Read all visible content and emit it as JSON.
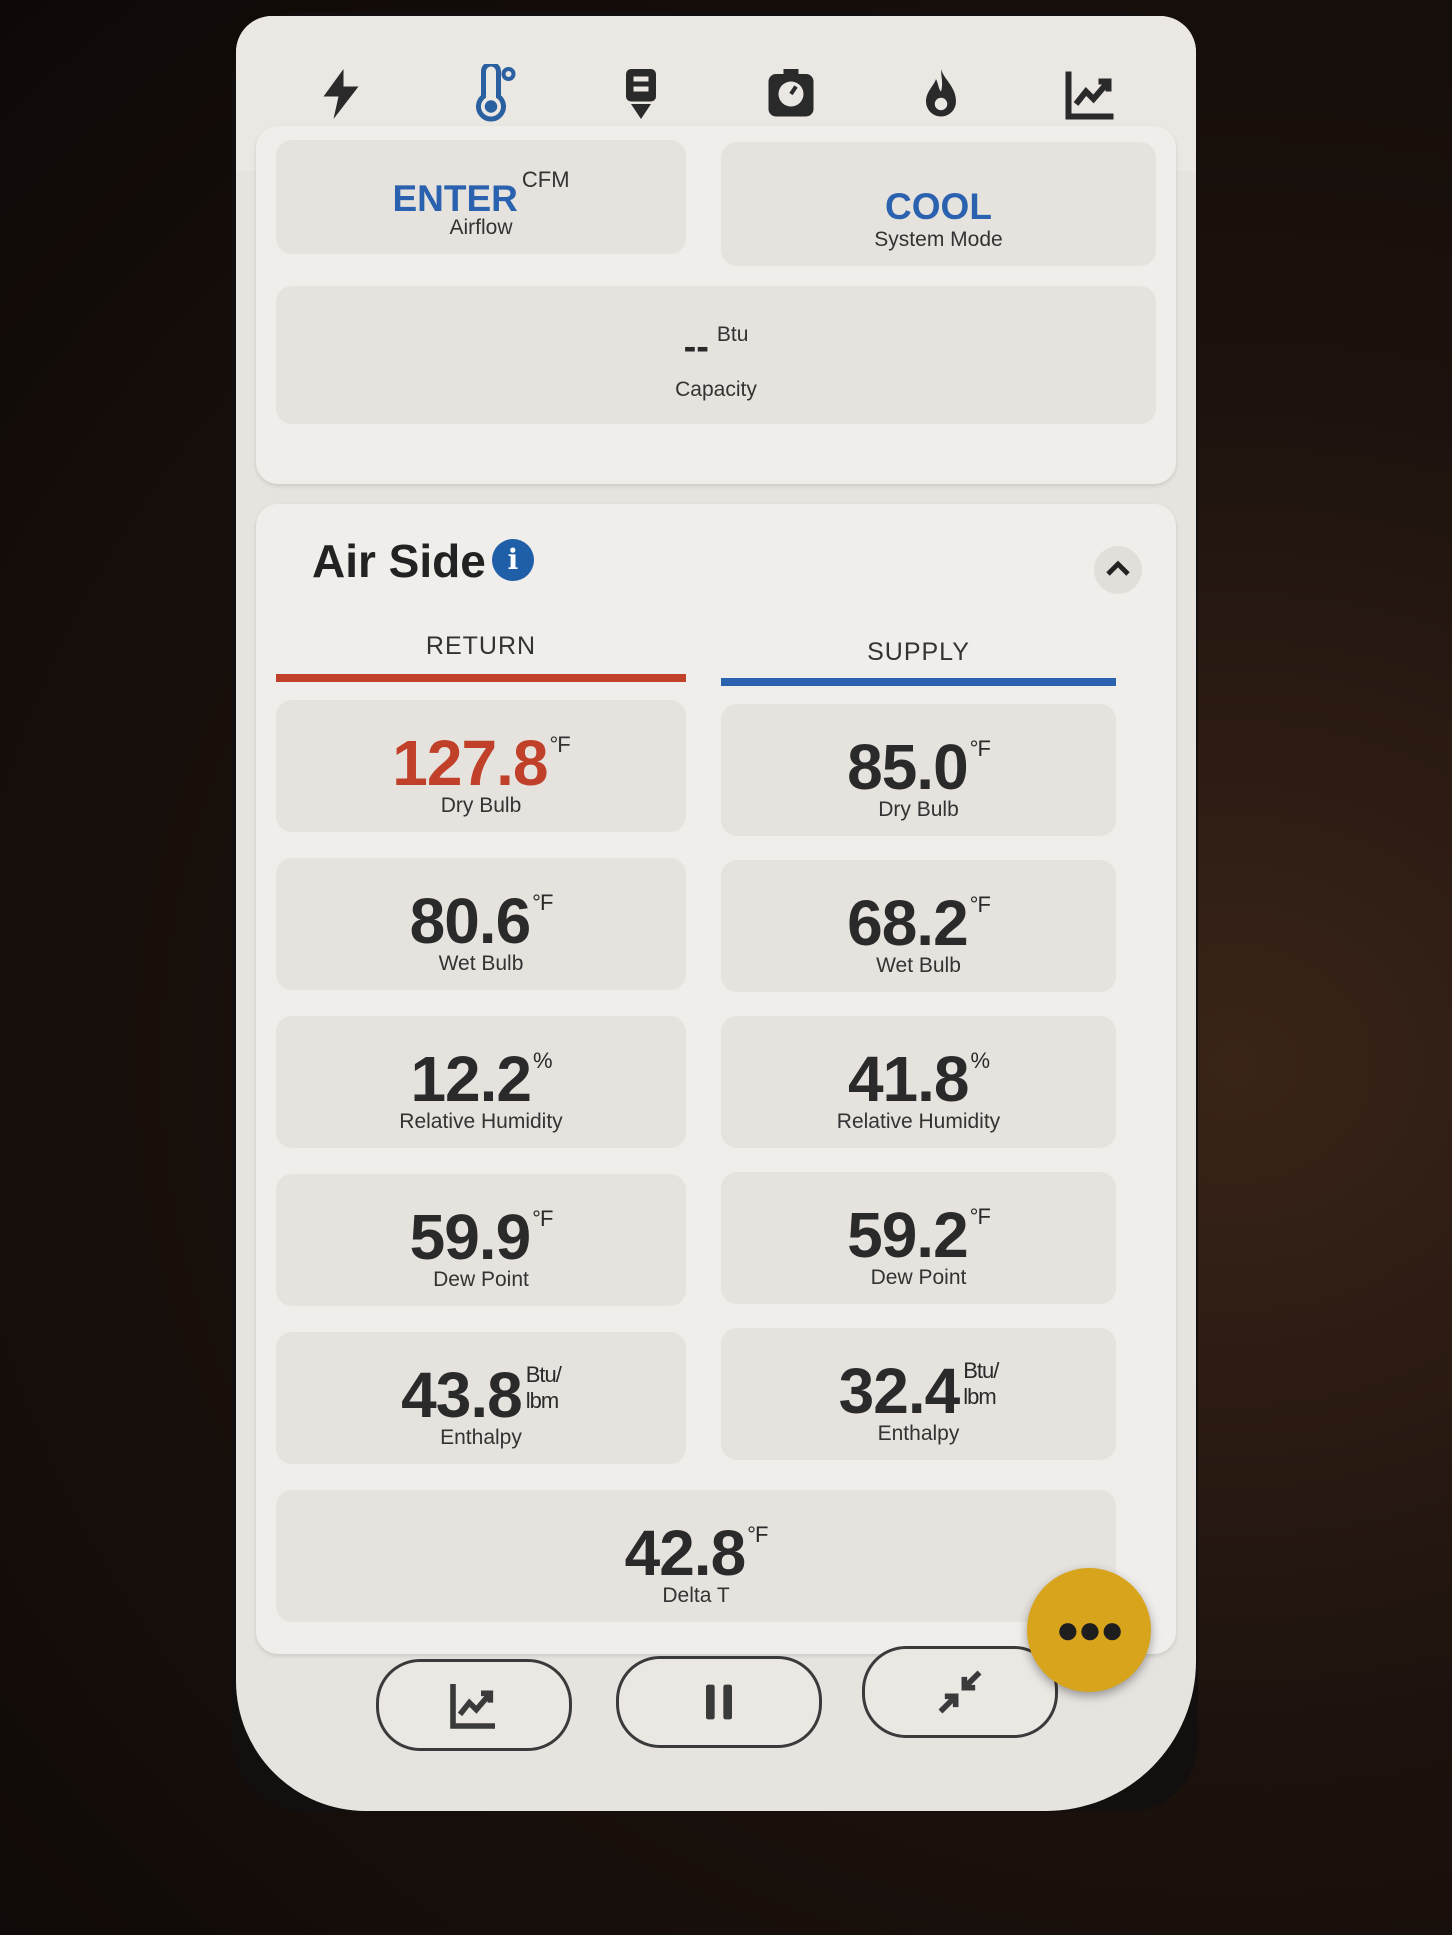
{
  "nav": {
    "icons": [
      "lightning-icon",
      "thermometer-icon",
      "download-probe-icon",
      "gauge-icon",
      "flame-icon",
      "chart-icon"
    ]
  },
  "summary": {
    "airflow": {
      "value": "ENTER",
      "unit": "CFM",
      "label": "Airflow"
    },
    "mode": {
      "value": "COOL",
      "label": "System Mode"
    },
    "capacity": {
      "value": "--",
      "unit": "Btu",
      "label": "Capacity"
    }
  },
  "airside": {
    "title": "Air Side",
    "return_label": "RETURN",
    "supply_label": "SUPPLY",
    "colors": {
      "return": "#c0402a",
      "supply": "#2a62b0",
      "return_value": "#c0402a"
    },
    "return": {
      "dry_bulb": {
        "value": "127.8",
        "unit": "°F",
        "label": "Dry Bulb"
      },
      "wet_bulb": {
        "value": "80.6",
        "unit": "°F",
        "label": "Wet Bulb"
      },
      "rh": {
        "value": "12.2",
        "unit": "%",
        "label": "Relative Humidity"
      },
      "dew_point": {
        "value": "59.9",
        "unit": "°F",
        "label": "Dew Point"
      },
      "enthalpy": {
        "value": "43.8",
        "unit_top": "Btu/",
        "unit_bottom": "lbm",
        "label": "Enthalpy"
      }
    },
    "supply": {
      "dry_bulb": {
        "value": "85.0",
        "unit": "°F",
        "label": "Dry Bulb"
      },
      "wet_bulb": {
        "value": "68.2",
        "unit": "°F",
        "label": "Wet Bulb"
      },
      "rh": {
        "value": "41.8",
        "unit": "%",
        "label": "Relative Humidity"
      },
      "dew_point": {
        "value": "59.2",
        "unit": "°F",
        "label": "Dew Point"
      },
      "enthalpy": {
        "value": "32.4",
        "unit_top": "Btu/",
        "unit_bottom": "lbm",
        "label": "Enthalpy"
      }
    },
    "delta_t": {
      "value": "42.8",
      "unit": "°F",
      "label": "Delta T"
    }
  },
  "bottom_bar": {
    "buttons": [
      "chart-icon",
      "pause-icon",
      "compress-icon"
    ],
    "fab": "more-icon",
    "fab_color": "#d8a41c"
  }
}
